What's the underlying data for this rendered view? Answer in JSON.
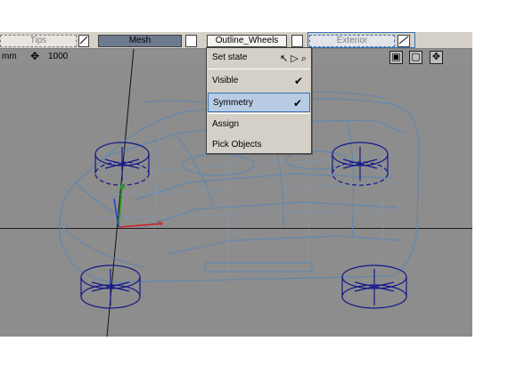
{
  "toolbar": {
    "tips": "Tips",
    "mesh": "Mesh",
    "outline": "Outline_Wheels",
    "exterior": "Exterior"
  },
  "viewport": {
    "units": "mm",
    "scale": "1000"
  },
  "menu": {
    "set_state": "Set state",
    "visible": "Visible",
    "symmetry": "Symmetry",
    "assign": "Assign",
    "pick_objects": "Pick Objects",
    "checked": [
      "Visible",
      "Symmetry"
    ]
  },
  "icons": {
    "scale": "move-cross-icon",
    "vp_tools": [
      "view-select-icon",
      "frame-icon",
      "pan-icon"
    ],
    "set_state_tools": [
      "pointer-icon",
      "arrow-right-icon",
      "zoom-icon"
    ]
  },
  "colors": {
    "viewport_bg": "#8d8d8d",
    "wheel_lines": "#14178a",
    "body_lines": "#5a87b3",
    "menu_highlight": "#b8cce4"
  }
}
